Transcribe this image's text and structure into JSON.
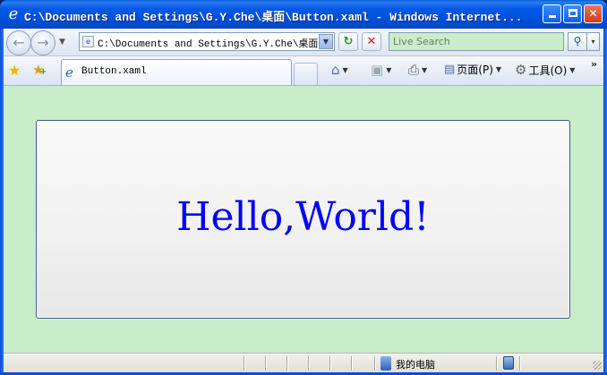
{
  "window": {
    "title": "C:\\Documents and Settings\\G.Y.Che\\桌面\\Button.xaml - Windows Internet...",
    "title_icon": "ie-icon",
    "minimize_glyph": "",
    "close_glyph": "✕"
  },
  "navigation": {
    "back_glyph": "←",
    "forward_glyph": "→",
    "history_dropdown_glyph": "▼"
  },
  "address_bar": {
    "url": "C:\\Documents and Settings\\G.Y.Che\\桌面\\Button.xaml",
    "dropdown_glyph": "▼",
    "refresh_glyph": "↻",
    "stop_glyph": "✕"
  },
  "search": {
    "placeholder": "Live Search",
    "button_glyph": "⚲",
    "dropdown_glyph": "▾"
  },
  "toolbar": {
    "favorites_glyph": "★",
    "add_favorites_glyph": "★",
    "add_plus": "+",
    "tab_label": "Button.xaml",
    "tab_icon_glyph": "e",
    "home_glyph": "⌂",
    "feeds_glyph": "▣",
    "print_glyph": "⎙",
    "page_label": "页面(P)",
    "page_glyph": "▤",
    "tools_label": "工具(O)",
    "tools_glyph": "⚙",
    "dropdown_glyph": "▼",
    "more_glyph": "»"
  },
  "content": {
    "background": "#c8edc8",
    "button_text": "Hello,World!",
    "button_text_color": "#0000ff"
  },
  "status_bar": {
    "zone_text": "我的电脑"
  }
}
